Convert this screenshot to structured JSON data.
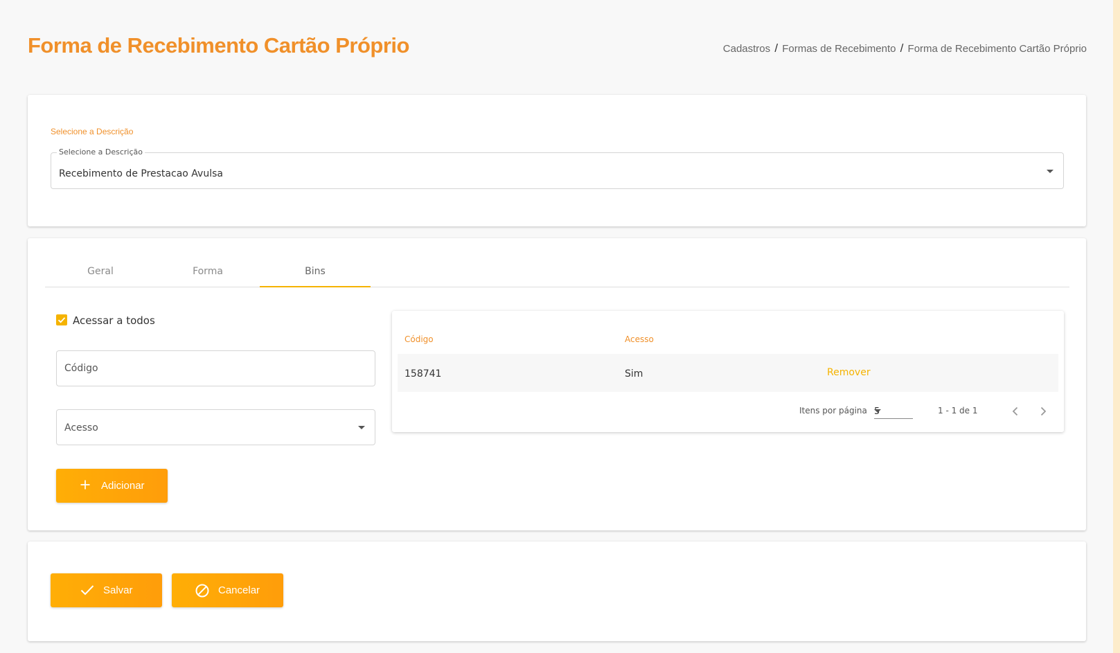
{
  "page": {
    "title": "Forma de Recebimento Cartão Próprio",
    "breadcrumb": [
      "Cadastros",
      "Formas de Recebimento",
      "Forma de Recebimento Cartão Próprio"
    ],
    "separator": "/"
  },
  "description_section": {
    "label": "Selecione a Descrição",
    "select_label": "Selecione a Descrição",
    "select_value": "Recebimento de Prestacao Avulsa"
  },
  "tabs": [
    {
      "label": "Geral",
      "active": false
    },
    {
      "label": "Forma",
      "active": false
    },
    {
      "label": "Bins",
      "active": true
    }
  ],
  "bins": {
    "access_all_label": "Acessar a todos",
    "access_all_checked": true,
    "codigo_placeholder": "Código",
    "acesso_placeholder": "Acesso",
    "add_button": "Adicionar",
    "table": {
      "columns": [
        "Código",
        "Acesso"
      ],
      "rows": [
        {
          "codigo": "158741",
          "acesso": "Sim",
          "action": "Remover"
        }
      ],
      "paginator": {
        "items_per_page_label": "Itens por página",
        "page_size": "5",
        "range": "1 - 1 de 1"
      }
    }
  },
  "actions": {
    "save": "Salvar",
    "cancel": "Cancelar"
  },
  "colors": {
    "accent": "#f5b300",
    "title": "#f0902a",
    "button": "#ffa708"
  }
}
